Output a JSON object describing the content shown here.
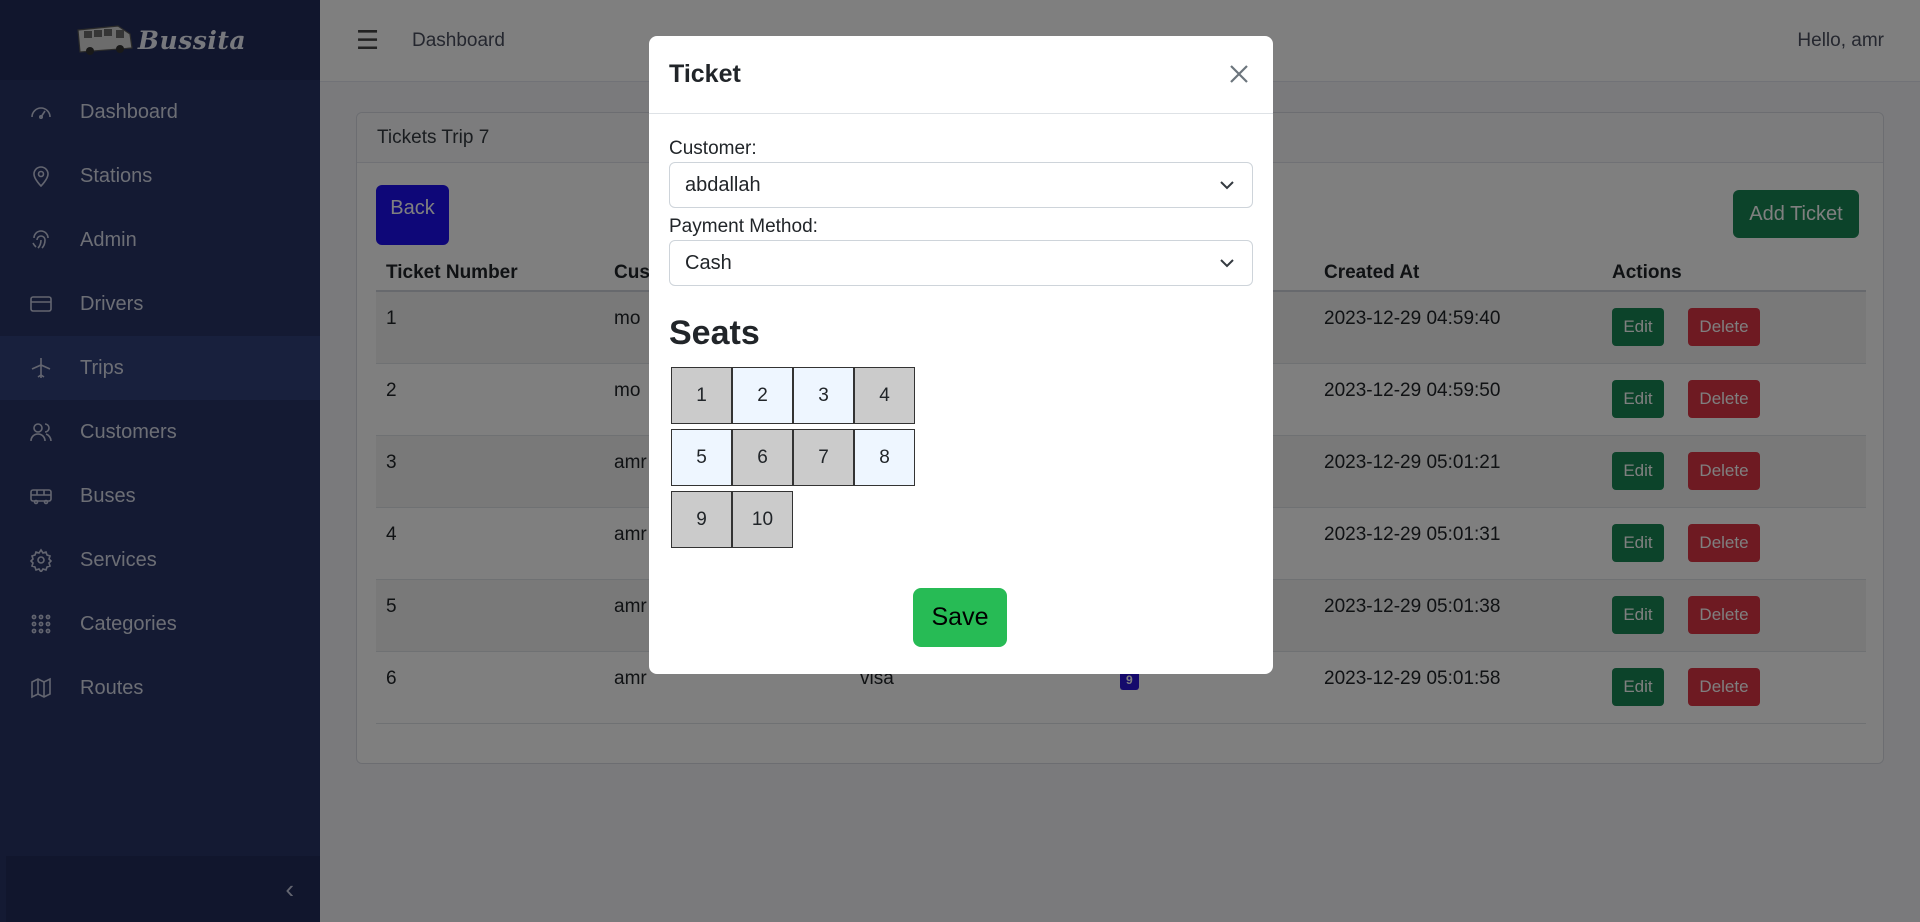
{
  "brand": {
    "name": "Bussita"
  },
  "sidebar": {
    "items": [
      {
        "label": "Dashboard",
        "icon": "dashboard-gauge-icon"
      },
      {
        "label": "Stations",
        "icon": "map-pin-icon"
      },
      {
        "label": "Admin",
        "icon": "fingerprint-icon"
      },
      {
        "label": "Drivers",
        "icon": "credit-card-icon"
      },
      {
        "label": "Trips",
        "icon": "airplane-icon",
        "active": true
      },
      {
        "label": "Customers",
        "icon": "users-icon"
      },
      {
        "label": "Buses",
        "icon": "bus-icon"
      },
      {
        "label": "Services",
        "icon": "gear-icon"
      },
      {
        "label": "Categories",
        "icon": "grid-dots-icon"
      },
      {
        "label": "Routes",
        "icon": "map-icon"
      }
    ],
    "collapse_glyph": "‹"
  },
  "topbar": {
    "menu_glyph": "☰",
    "breadcrumb": "Dashboard",
    "greeting": "Hello, amr"
  },
  "card": {
    "title": "Tickets Trip 7",
    "back_label": "Back",
    "add_label": "Add Ticket",
    "columns": [
      "Ticket Number",
      "Cus",
      "",
      "",
      "Created At",
      "Actions"
    ],
    "rows": [
      {
        "number": "1",
        "customer": "mo",
        "payment": "",
        "seat": "",
        "created": "2023-12-29 04:59:40"
      },
      {
        "number": "2",
        "customer": "mo",
        "payment": "",
        "seat": "",
        "created": "2023-12-29 04:59:50"
      },
      {
        "number": "3",
        "customer": "amr",
        "payment": "",
        "seat": "",
        "created": "2023-12-29 05:01:21"
      },
      {
        "number": "4",
        "customer": "amr",
        "payment": "",
        "seat": "",
        "created": "2023-12-29 05:01:31"
      },
      {
        "number": "5",
        "customer": "amr",
        "payment": "",
        "seat": "",
        "created": "2023-12-29 05:01:38"
      },
      {
        "number": "6",
        "customer": "amr",
        "payment": "visa",
        "seat": "9",
        "created": "2023-12-29 05:01:58"
      }
    ],
    "edit_label": "Edit",
    "delete_label": "Delete"
  },
  "modal": {
    "title": "Ticket",
    "customer_label": "Customer:",
    "customer_value": "abdallah",
    "payment_label": "Payment Method:",
    "payment_value": "Cash",
    "seats_title": "Seats",
    "seats": [
      {
        "n": "1",
        "status": "taken"
      },
      {
        "n": "2",
        "status": "free"
      },
      {
        "n": "3",
        "status": "free"
      },
      {
        "n": "4",
        "status": "taken"
      },
      {
        "n": "5",
        "status": "free"
      },
      {
        "n": "6",
        "status": "taken"
      },
      {
        "n": "7",
        "status": "taken"
      },
      {
        "n": "8",
        "status": "free"
      },
      {
        "n": "9",
        "status": "taken"
      },
      {
        "n": "10",
        "status": "taken"
      }
    ],
    "save_label": "Save"
  },
  "colors": {
    "sidebar": "#283466",
    "back_button": "#1d0ef0",
    "success": "#198754",
    "danger": "#dc3545",
    "save": "#27bb55"
  }
}
